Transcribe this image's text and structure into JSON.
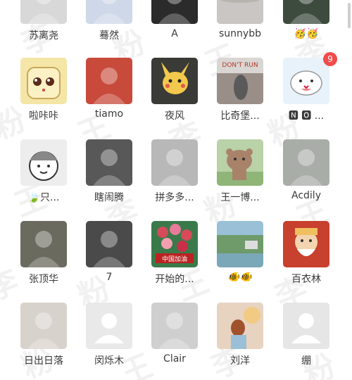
{
  "members": [
    {
      "name": "苏离尧",
      "avatar": "person-photo-icon",
      "color": "#d8d8d8"
    },
    {
      "name": "蓦然",
      "avatar": "girl-cartoon-icon",
      "color": "#cfd8e8"
    },
    {
      "name": "A",
      "avatar": "man-photo-icon",
      "color": "#2b2b2b"
    },
    {
      "name": "sunnybb",
      "avatar": "landscape-icon",
      "color": "#c9c6c4"
    },
    {
      "name": "🥳🥳",
      "avatar": "dark-photo-icon",
      "color": "#3d4a3e"
    },
    {
      "name": "啦咔咔",
      "avatar": "toast-cartoon-icon",
      "color": "#f4e6a6"
    },
    {
      "name": "tiamo",
      "avatar": "girl-red-photo-icon",
      "color": "#c84a3a"
    },
    {
      "name": "夜风",
      "avatar": "pikachu-icon",
      "color": "#3a3a36",
      "accent": "#f2c94c"
    },
    {
      "name": "比奇堡...",
      "avatar": "dont-run-icon",
      "color": "#9a8f88",
      "text": "DON'T RUN"
    },
    {
      "name": "🅽 🅾 ...",
      "avatar": "cat-sticker-icon",
      "color": "#e8f2fb",
      "badge": "9"
    },
    {
      "name": "🍃只...",
      "avatar": "cartoon-kid-icon",
      "color": "#ededed"
    },
    {
      "name": "瞎闹腾",
      "avatar": "fitness-photo-icon",
      "color": "#585858"
    },
    {
      "name": "拼多多...",
      "avatar": "back-photo-icon",
      "color": "#b8b8b8"
    },
    {
      "name": "王一博...",
      "avatar": "bear-cartoon-icon",
      "color": "#b9d2a8",
      "accent": "#a8836a"
    },
    {
      "name": "Acdily",
      "avatar": "device-photo-icon",
      "color": "#a9ada8"
    },
    {
      "name": "张顶华",
      "avatar": "lying-photo-icon",
      "color": "#6a6a5e"
    },
    {
      "name": "7",
      "avatar": "hoodie-photo-icon",
      "color": "#4a4a4a"
    },
    {
      "name": "开始的...",
      "avatar": "flowers-icon",
      "color": "#3a7a4a",
      "accent": "#d64a5a",
      "text": "中国加油"
    },
    {
      "name": "🐠🐠",
      "avatar": "garden-photo-icon",
      "color": "#6f9a6a",
      "accent": "#9ac0d8"
    },
    {
      "name": "百衣林",
      "avatar": "god-painting-icon",
      "color": "#c8402e",
      "accent": "#f0c060"
    },
    {
      "name": "日出日落",
      "avatar": "woman-portrait-icon",
      "color": "#d8d2cc"
    },
    {
      "name": "闵烁木",
      "avatar": "default-avatar-icon",
      "color": "#e9e9e9"
    },
    {
      "name": "Clair",
      "avatar": "bw-photo-icon",
      "color": "#cfcfcf"
    },
    {
      "name": "刘洋",
      "avatar": "pastel-photo-icon",
      "color": "#e7d3c0",
      "accent": "#f5c86a"
    },
    {
      "name": "绷",
      "avatar": "default-avatar-icon",
      "color": "#e6e6e6"
    }
  ],
  "watermark_text": "李 粉 王"
}
